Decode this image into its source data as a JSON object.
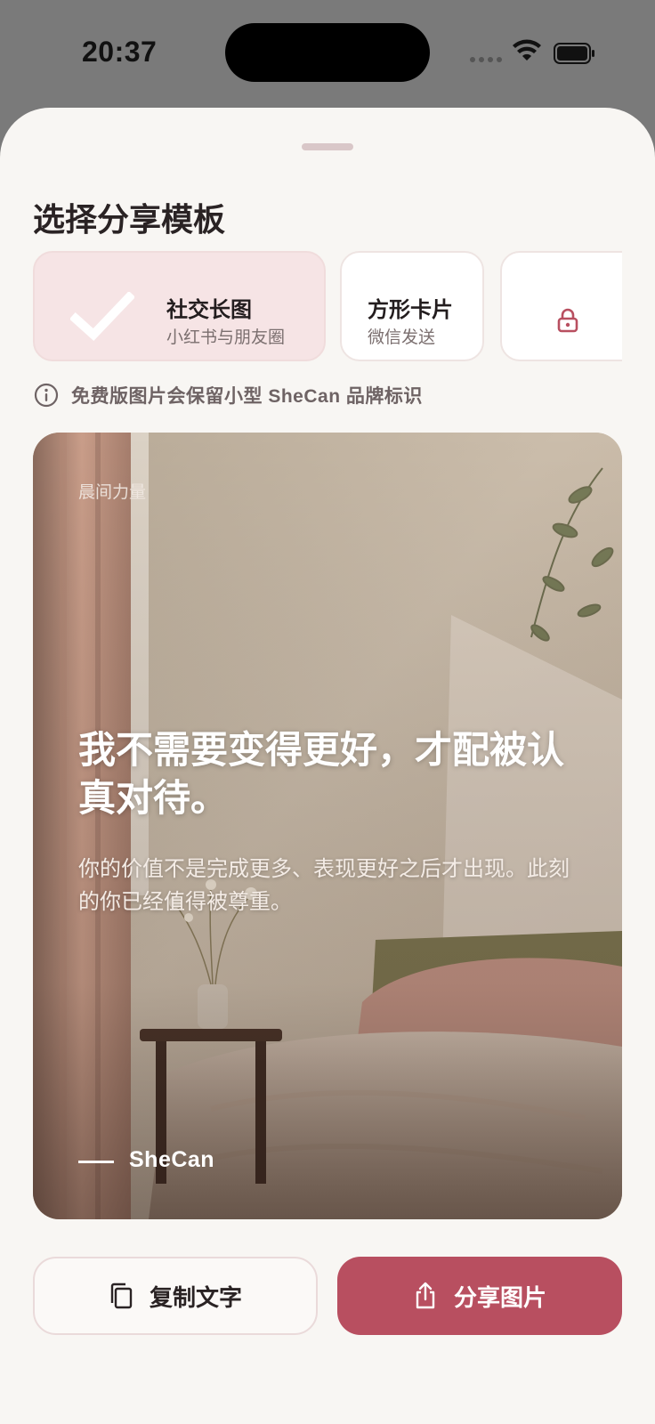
{
  "status_bar": {
    "time": "20:37"
  },
  "sheet": {
    "title": "选择分享模板",
    "templates": [
      {
        "name": "社交长图",
        "subtitle": "小红书与朋友圈",
        "selected": true
      },
      {
        "name": "方形卡片",
        "subtitle": "微信发送",
        "selected": false
      },
      {
        "name": "",
        "subtitle": "",
        "selected": false,
        "locked": true,
        "icon": "lock-icon"
      }
    ],
    "notice": "免费版图片会保留小型 SheCan 品牌标识"
  },
  "preview": {
    "kicker": "晨间力量",
    "quote": "我不需要变得更好，才配被认真对待。",
    "body": "你的价值不是完成更多、表现更好之后才出现。此刻的你已经值得被尊重。",
    "brand": "SheCan"
  },
  "actions": {
    "copy_label": "复制文字",
    "share_label": "分享图片"
  },
  "colors": {
    "accent": "#b84f60",
    "selected_card_bg": "#f6e4e5",
    "sheet_bg": "#f8f6f3"
  }
}
